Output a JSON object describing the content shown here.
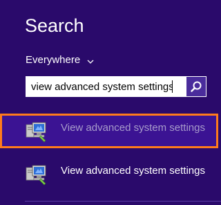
{
  "search": {
    "title": "Search",
    "scope_label": "Everywhere",
    "query": "view advanced system settings"
  },
  "results": [
    {
      "label": "View advanced system settings",
      "icon": "system-computer-icon",
      "selected": true
    },
    {
      "label": "View advanced system settings",
      "icon": "system-computer-icon",
      "selected": false
    }
  ],
  "colors": {
    "background": "#2a0a6b",
    "highlight_border": "#ff7b1c",
    "search_button": "#4a2c9c",
    "selected_text": "#a89ccb"
  }
}
